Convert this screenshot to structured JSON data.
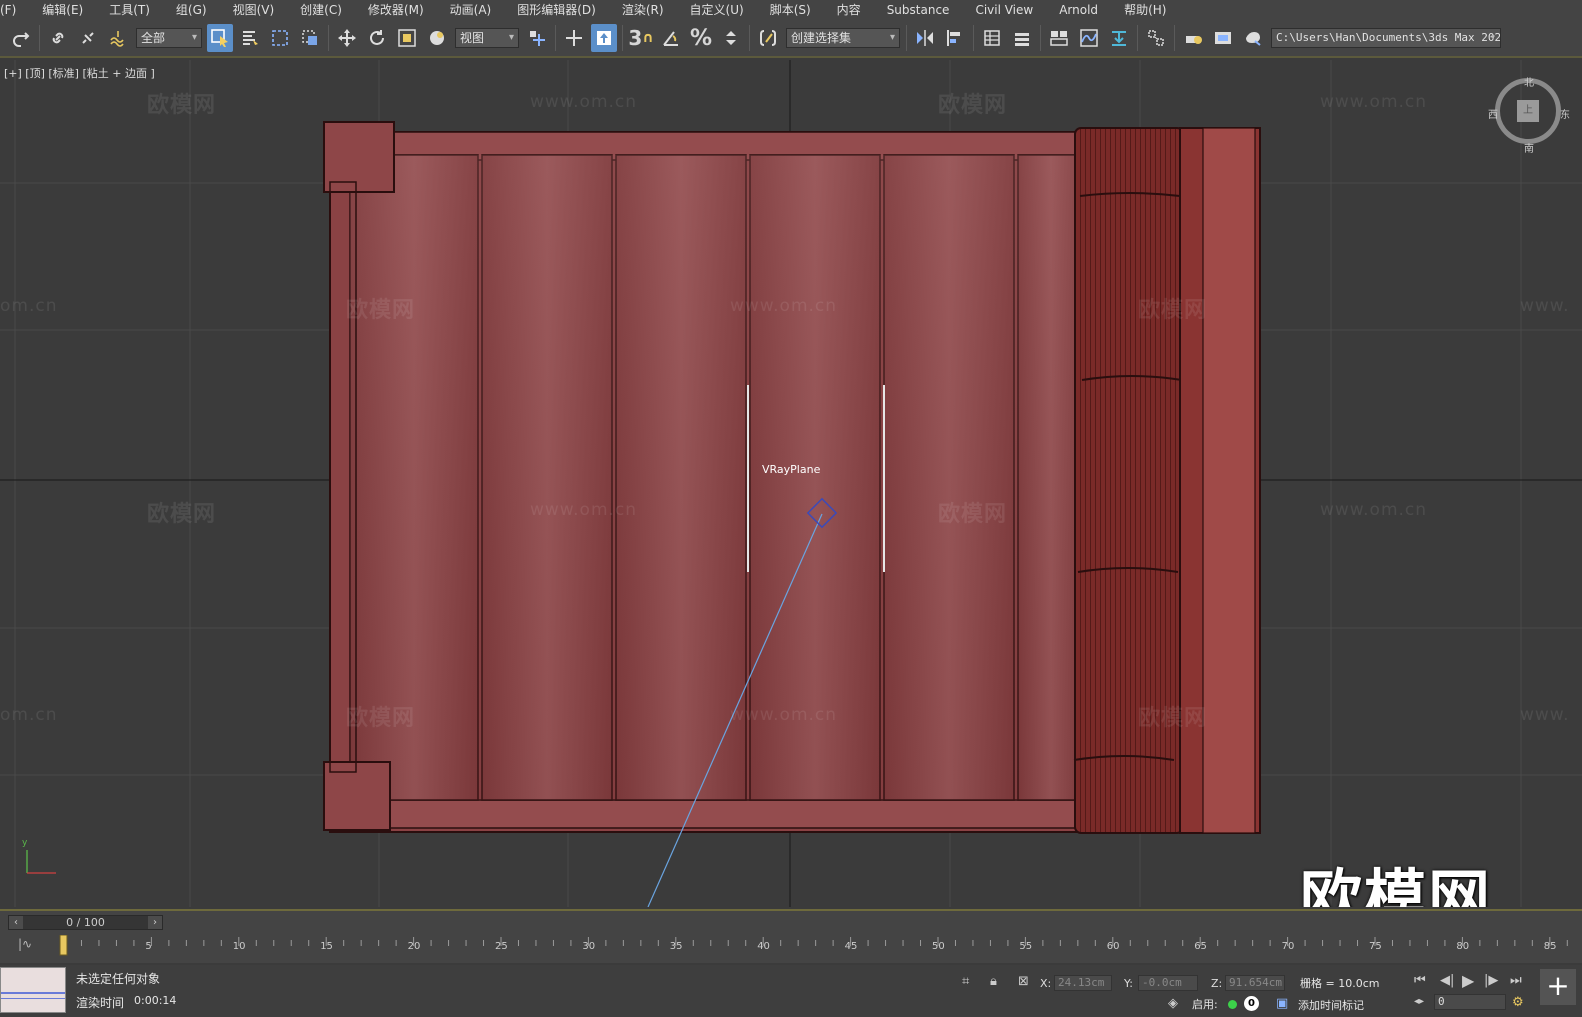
{
  "menu": [
    "(F)",
    "编辑(E)",
    "工具(T)",
    "组(G)",
    "视图(V)",
    "创建(C)",
    "修改器(M)",
    "动画(A)",
    "图形编辑器(D)",
    "渲染(R)",
    "自定义(U)",
    "脚本(S)",
    "内容",
    "Substance",
    "Civil View",
    "Arnold",
    "帮助(H)"
  ],
  "toolbar": {
    "selection_filter": "全部",
    "ref_coord": "视图",
    "named_selection": "创建选择集",
    "project_path": "C:\\Users\\Han\\Documents\\3ds Max 2022",
    "snap_3": "3",
    "percent": "%"
  },
  "viewport": {
    "label": "[+] [顶] [标准] [粘土 + 边面 ]",
    "object_label": "VRayPlane",
    "viewcube": {
      "face": "上",
      "north": "北",
      "south": "南",
      "west": "西",
      "east": "东"
    },
    "watermark_logo": "欧模网",
    "watermark_url": "www.om.cn",
    "watermark_url_partial": "om.cn",
    "watermark_url_right": "www.",
    "axis_y": "y",
    "big_logo": "欧模网"
  },
  "timeline": {
    "frame_display": "0 / 100",
    "ticks": [
      "5",
      "10",
      "15",
      "20",
      "25",
      "30",
      "35",
      "40",
      "45",
      "50",
      "55",
      "60",
      "65",
      "70",
      "75",
      "80",
      "85"
    ]
  },
  "status": {
    "selection": "未选定任何对象",
    "render_time_label": "渲染时间",
    "render_time": "0:00:14",
    "x_label": "X:",
    "x_value": "24.13cm",
    "y_label": "Y:",
    "y_value": "-0.0cm",
    "z_label": "Z:",
    "z_value": "91.654cm",
    "grid": "栅格 = 10.0cm",
    "enable_label": "启用:",
    "enable_count": "0",
    "add_time_tag": "添加时间标记",
    "current_frame": "0"
  },
  "colors": {
    "wood": "#8f4648",
    "viewport_bg": "#3b3b3b",
    "active_tool": "#5b8fc9",
    "timeline_accent": "#6e6a3c"
  }
}
